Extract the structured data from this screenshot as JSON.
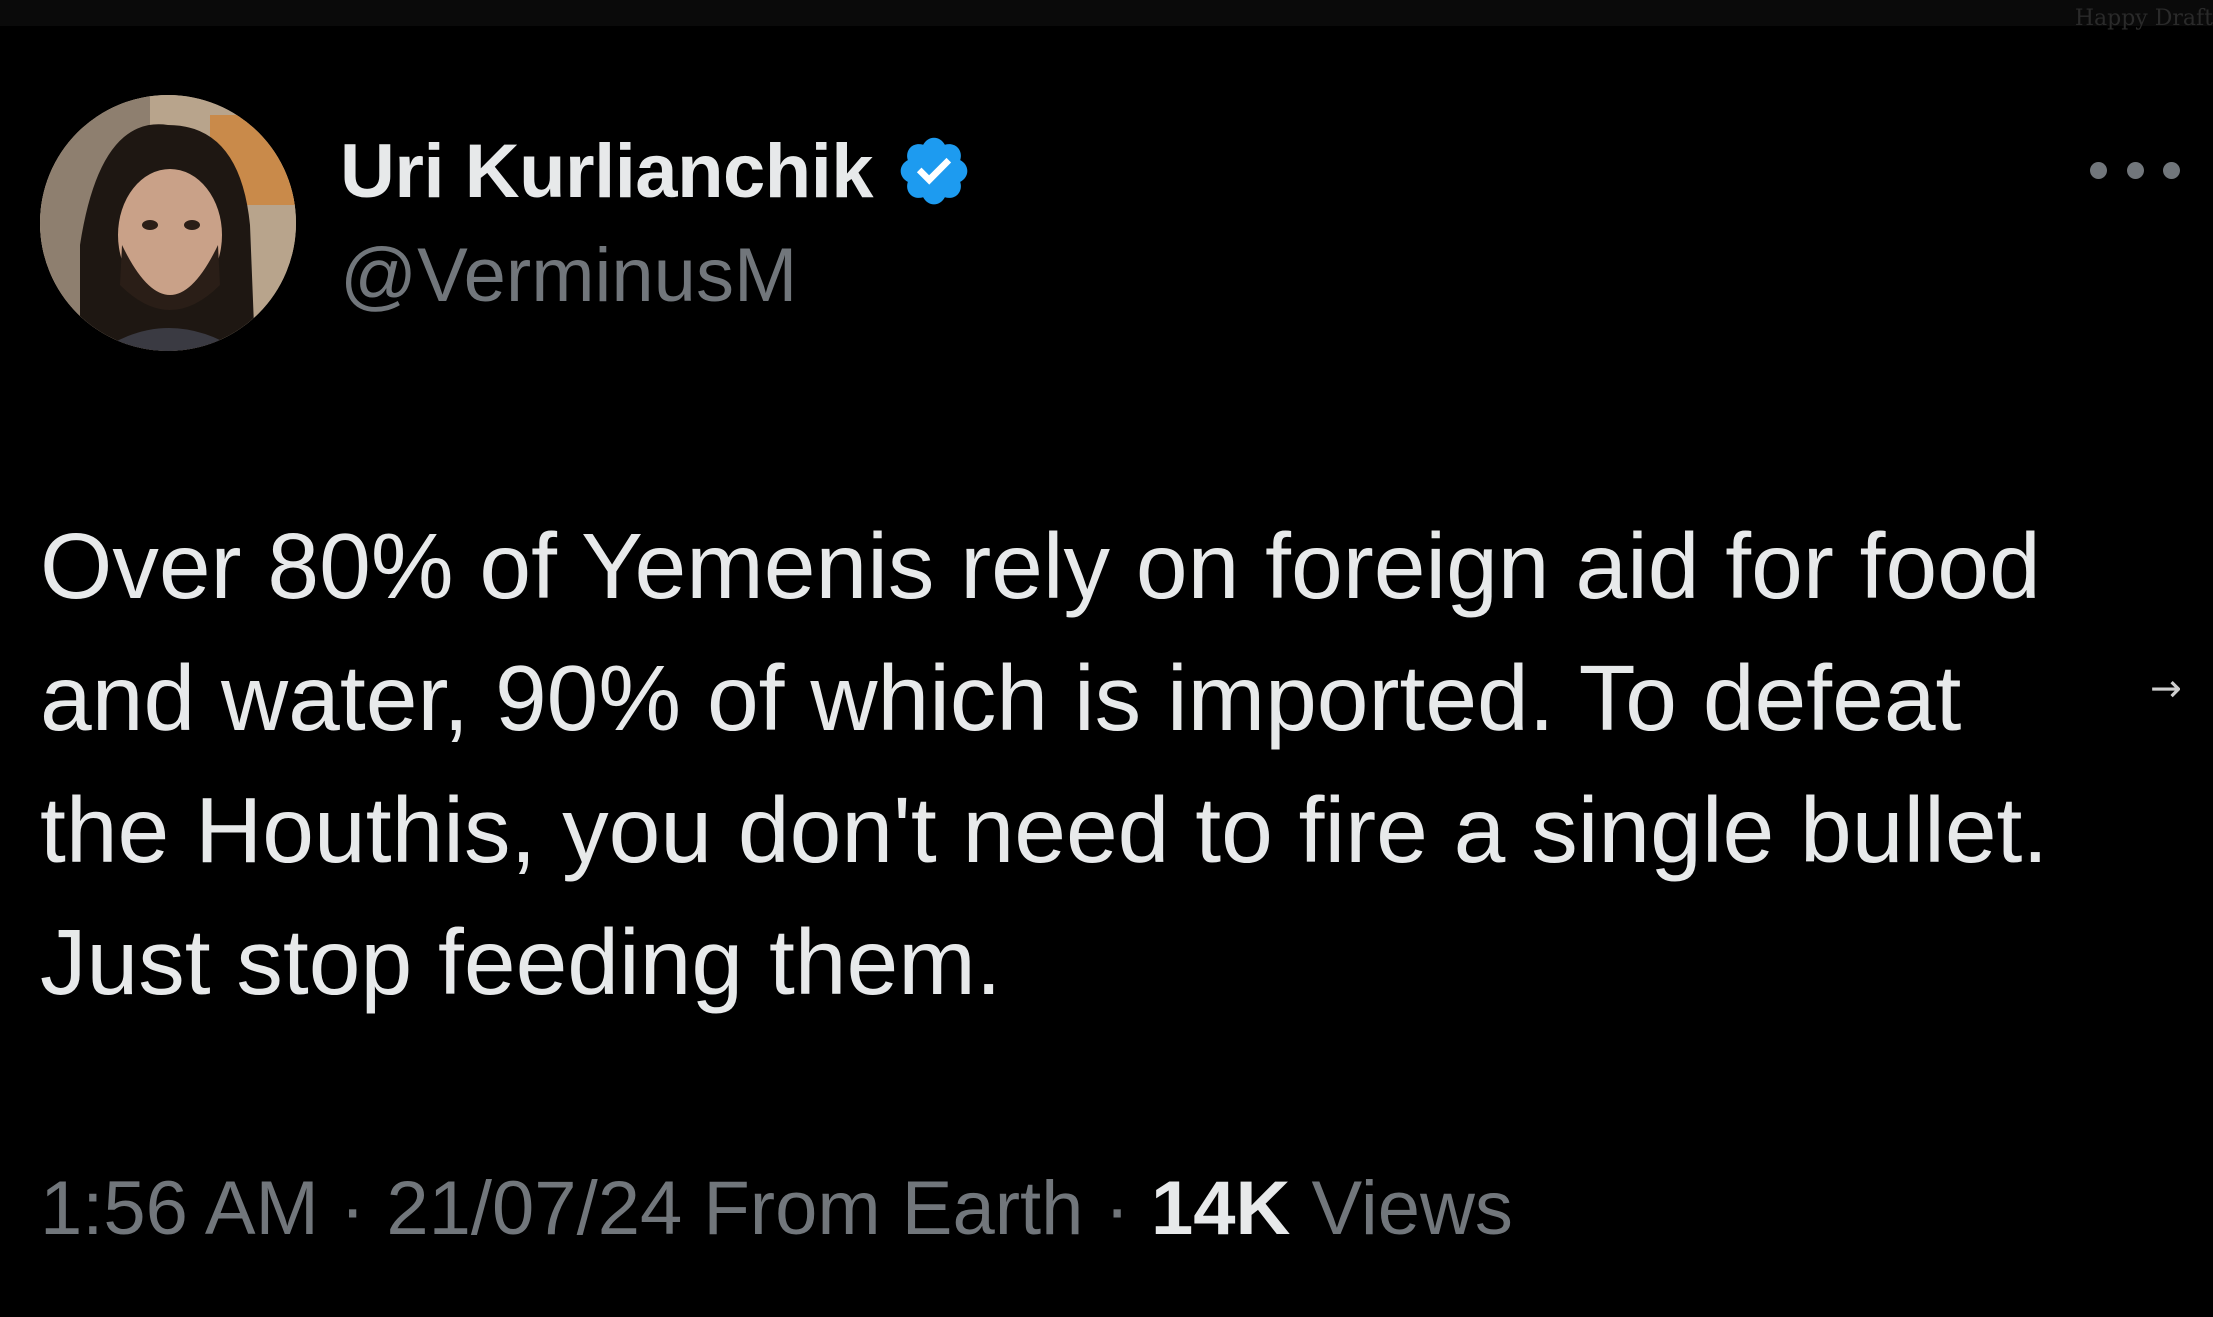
{
  "watermark": "Happy Draft",
  "author": {
    "display_name": "Uri Kurlianchik",
    "handle": "@VerminusM",
    "avatar_icon": "avatar-photo",
    "verified_icon": "verified-badge-icon"
  },
  "more_icon": "more-options-icon",
  "tweet": {
    "lines": [
      "Over 80% of Yemenis rely on foreign aid for food",
      "and water, 90% of which is imported. To defeat",
      "the Houthis, you don't need to fire a single bullet.",
      "Just stop feeding them."
    ]
  },
  "expand_arrow": "→",
  "meta": {
    "time": "1:56 AM",
    "separator": " · ",
    "date": "21/07/24",
    "source": " From Earth",
    "views_count": "14K",
    "views_label": " Views"
  },
  "colors": {
    "background": "#000000",
    "primary_text": "#e7e9ea",
    "secondary_text": "#71767b",
    "verified_blue": "#1d9bf0"
  }
}
